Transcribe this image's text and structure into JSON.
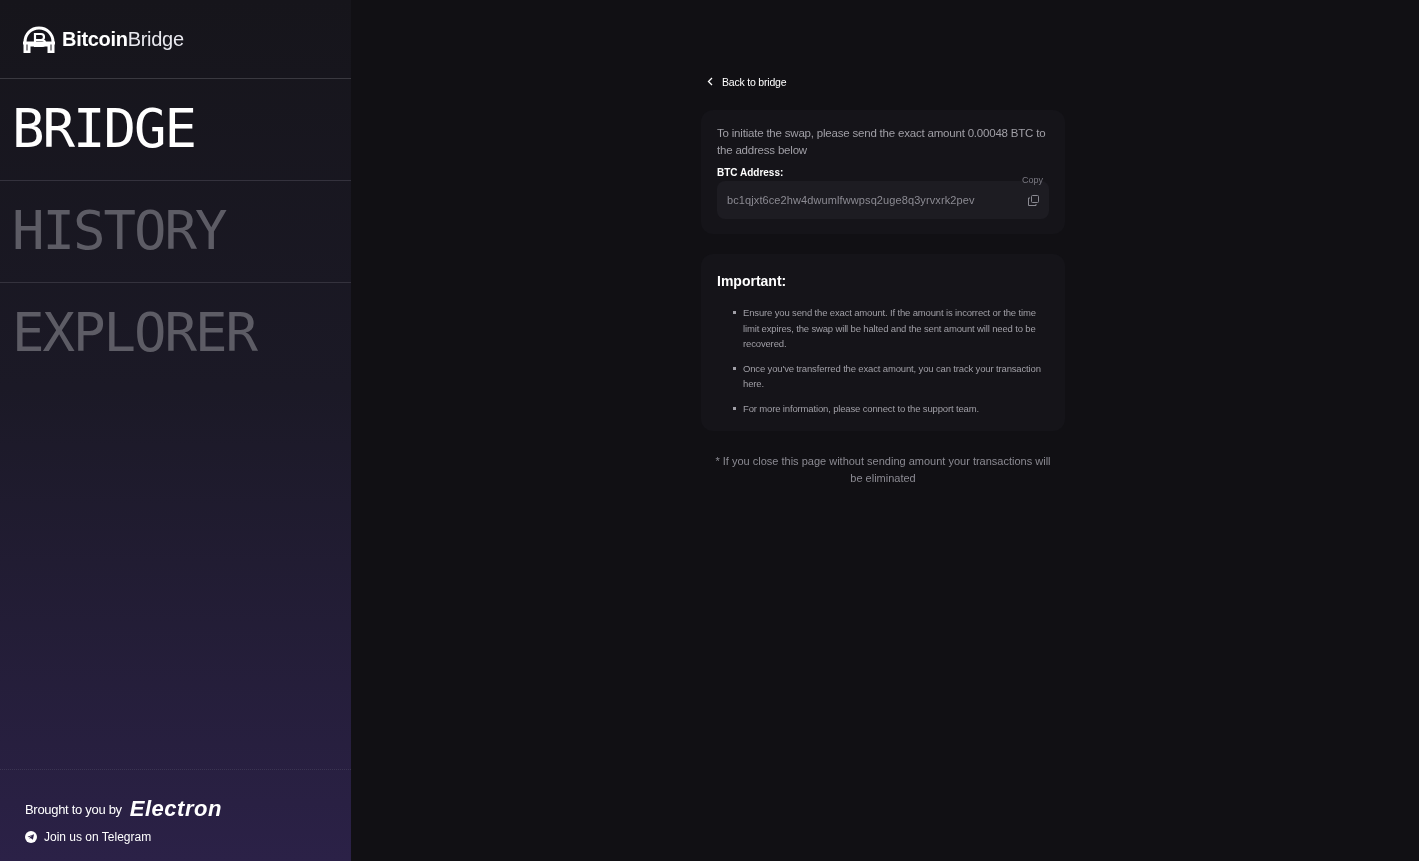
{
  "sidebar": {
    "logo": "**Bitcoin**Bridge",
    "nav": [
      {
        "label": "BRIDGE",
        "selected": true
      },
      {
        "label": "HISTORY",
        "selected": false
      },
      {
        "label": "EXPLORER",
        "selected": false
      }
    ],
    "footer": {
      "credit": "Brought to you by",
      "brand": "Electron",
      "telegram": "Join us on Telegram"
    }
  },
  "main": {
    "back_link": "Back to bridge",
    "instruction": "To initiate the swap, please send the exact amount 0.00048 BTC to the address below",
    "address_label": "BTC Address:",
    "address": "bc1qjxt6ce2hw4dwumlfwwpsq2uge8q3yrvxrk2pev",
    "copy_tooltip": "Copy",
    "important": {
      "title": "Important:",
      "items": [
        "Ensure you send the exact amount. If the amount is incorrect or the time limit expires, the swap will be halted and the sent amount will need to be recovered.",
        "Once you've transferred the exact amount, you can track your transaction here.",
        "For more information, please connect to the support team."
      ]
    },
    "note": "* If you close this page without sending amount your transactions will be eliminated"
  }
}
